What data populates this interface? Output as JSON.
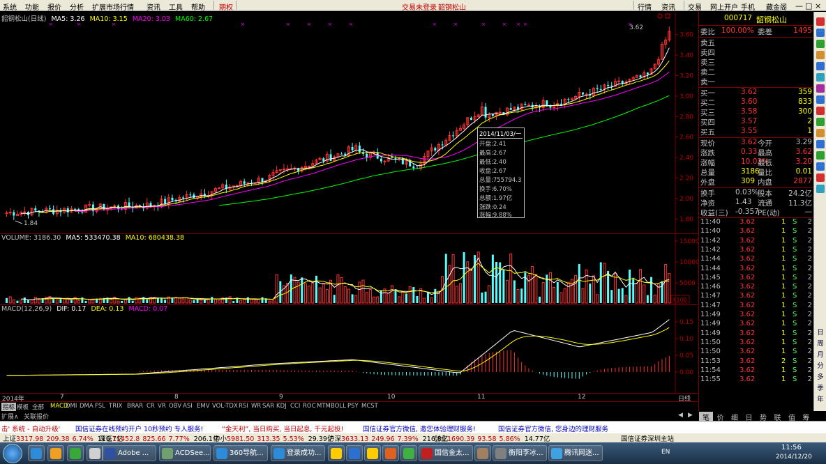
{
  "menu": {
    "items": [
      "系统",
      "功能",
      "报价",
      "分析",
      "扩展市场行情",
      "资讯",
      "工具",
      "帮助"
    ],
    "qiquan": "期权",
    "status_left": "交易未登录",
    "status_name": "韶钢松山",
    "right": [
      "行情",
      "资讯",
      "交易",
      "网上开户",
      "手机",
      "藏金阁"
    ]
  },
  "kline": {
    "title": "韶钢松山(日线)",
    "ma5_label": "MA5: 3.26",
    "ma10_label": "MA10: 3.15",
    "ma20_label": "MA20: 3.03",
    "ma60_label": "MA60: 2.67",
    "last_label": "3.62",
    "low_label": "1.84",
    "price_axis": [
      "3.60",
      "3.40",
      "3.20",
      "3.00",
      "2.80",
      "2.60",
      "2.40",
      "2.20",
      "2.00",
      "1.80"
    ]
  },
  "volume": {
    "title": "VOLUME: 3186.30",
    "ma5": "MA5: 533470.38",
    "ma10": "MA10: 680438.38",
    "axis": [
      "15000",
      "10000",
      "5000"
    ],
    "unit": "X100"
  },
  "macd": {
    "title": "MACD(12,26,9)",
    "dif": "DIF: 0.17",
    "dea": "DEA: 0.13",
    "macd": "MACD: 0.07",
    "axis": [
      "0.15",
      "0.10",
      "0.05",
      "0.00"
    ]
  },
  "xaxis": {
    "labels": [
      "2014年",
      "7",
      "8",
      "9",
      "10",
      "11",
      "12"
    ],
    "period": "日线"
  },
  "tooltip": {
    "date": "2014/11/03/一",
    "lines": [
      "开盘:2.41",
      "最高:2.67",
      "最低:2.40",
      "收盘:2.67",
      "总量:755794.3",
      "换手:6.70%",
      "总额:1.97亿",
      "涨跌:0.24",
      "涨幅:9.88%"
    ]
  },
  "tabs": [
    "指标",
    "模板",
    "全部",
    "MACD",
    "DMI",
    "DMA",
    "FSL",
    "TRIX",
    "BRAR",
    "CR",
    "VR",
    "OBV",
    "ASI",
    "EMV",
    "VOL-TDX",
    "RSI",
    "WR",
    "SAR",
    "KDJ",
    "CCI",
    "ROC",
    "MTM",
    "BOLL",
    "PSY",
    "MCST"
  ],
  "tabs2": [
    "扩展∧",
    "关联报价"
  ],
  "quote": {
    "code": "000717",
    "name": "韶钢松山",
    "weibi_label": "委比",
    "weibi": "100.00%",
    "weicha_label": "委差",
    "weicha": "1495",
    "sells": [
      "卖五",
      "卖四",
      "卖三",
      "卖二",
      "卖一"
    ],
    "buys": [
      {
        "label": "买一",
        "price": "3.62",
        "vol": "359"
      },
      {
        "label": "买二",
        "price": "3.60",
        "vol": "833"
      },
      {
        "label": "买三",
        "price": "3.58",
        "vol": "300"
      },
      {
        "label": "买四",
        "price": "3.57",
        "vol": "2"
      },
      {
        "label": "买五",
        "price": "3.55",
        "vol": "1"
      }
    ],
    "stats": [
      {
        "l1": "现价",
        "v1": "3.62",
        "l2": "今开",
        "v2": "3.29"
      },
      {
        "l1": "涨跌",
        "v1": "0.33",
        "l2": "最高",
        "v2": "3.62"
      },
      {
        "l1": "涨幅",
        "v1": "10.03%",
        "l2": "最低",
        "v2": "3.20"
      },
      {
        "l1": "总量",
        "v1": "3186",
        "l2": "量比",
        "v2": "0.01"
      },
      {
        "l1": "外盘",
        "v1": "309",
        "l2": "内盘",
        "v2": "2877"
      }
    ],
    "stats2": [
      {
        "l1": "换手",
        "v1": "0.03%",
        "l2": "股本",
        "v2": "24.2亿"
      },
      {
        "l1": "净资",
        "v1": "1.43",
        "l2": "流通",
        "v2": "11.3亿"
      },
      {
        "l1": "收益(三)",
        "v1": "-0.357",
        "l2": "PE(动)",
        "v2": "—"
      }
    ],
    "ticks": [
      {
        "t": "11:40",
        "p": "3.62",
        "v": "1",
        "s": "S",
        "n": "2"
      },
      {
        "t": "11:40",
        "p": "3.62",
        "v": "1",
        "s": "S",
        "n": "2"
      },
      {
        "t": "11:42",
        "p": "3.62",
        "v": "1",
        "s": "S",
        "n": "2"
      },
      {
        "t": "11:42",
        "p": "3.62",
        "v": "1",
        "s": "S",
        "n": "2"
      },
      {
        "t": "11:44",
        "p": "3.62",
        "v": "1",
        "s": "S",
        "n": "2"
      },
      {
        "t": "11:44",
        "p": "3.62",
        "v": "1",
        "s": "S",
        "n": "2"
      },
      {
        "t": "11:45",
        "p": "3.62",
        "v": "1",
        "s": "S",
        "n": "2"
      },
      {
        "t": "11:46",
        "p": "3.62",
        "v": "1",
        "s": "S",
        "n": "2"
      },
      {
        "t": "11:47",
        "p": "3.62",
        "v": "1",
        "s": "S",
        "n": "2"
      },
      {
        "t": "11:47",
        "p": "3.62",
        "v": "1",
        "s": "S",
        "n": "2"
      },
      {
        "t": "11:49",
        "p": "3.62",
        "v": "1",
        "s": "S",
        "n": "2"
      },
      {
        "t": "11:49",
        "p": "3.62",
        "v": "1",
        "s": "S",
        "n": "2"
      },
      {
        "t": "11:49",
        "p": "3.62",
        "v": "1",
        "s": "S",
        "n": "2"
      },
      {
        "t": "11:50",
        "p": "3.62",
        "v": "1",
        "s": "S",
        "n": "2"
      },
      {
        "t": "11:50",
        "p": "3.62",
        "v": "1",
        "s": "S",
        "n": "2"
      },
      {
        "t": "11:53",
        "p": "3.62",
        "v": "2",
        "s": "S",
        "n": "2"
      },
      {
        "t": "11:54",
        "p": "3.62",
        "v": "1",
        "s": "S",
        "n": "2"
      },
      {
        "t": "11:55",
        "p": "3.62",
        "v": "1",
        "s": "S",
        "n": "2"
      }
    ]
  },
  "bottom_tabs": [
    "笔",
    "价",
    "细",
    "日",
    "势",
    "联",
    "值",
    "筹"
  ],
  "side_labels": [
    "日",
    "周",
    "月",
    "分",
    "多",
    "季",
    "年"
  ],
  "ticker": [
    "击' 系统 - 自动升级'",
    "国信证券在线预约开户 10秒预约 专人服务!",
    "“金天利”, 当日购买, 当日起息, 千元起投!",
    "国信证券官方微信, 邀您体验理财服务!",
    "国信证券官方微信, 您身边的理财服务"
  ],
  "index": [
    {
      "n": "上证",
      "v": "3317.98",
      "c": "209.38",
      "p": "6.74%",
      "a": "116.7亿"
    },
    {
      "n": "深证",
      "v": "11452.8",
      "c": "825.66",
      "p": "7.77%",
      "a": "206.1亿"
    },
    {
      "n": "中小",
      "v": "5981.50",
      "c": "313.35",
      "p": "5.53%",
      "a": "29.39亿"
    },
    {
      "n": "沪深",
      "v": "3633.13",
      "c": "249.96",
      "p": "7.39%",
      "a": "216.8亿"
    },
    {
      "n": "创业",
      "v": "1690.39",
      "c": "93.58",
      "p": "5.86%",
      "a": "14.77亿"
    }
  ],
  "index_right": "国信证券深圳主站",
  "taskbar": {
    "items": [
      "",
      "",
      "",
      "",
      "Adobe ...",
      "ACDSee...",
      "360导航...",
      "登录成功...",
      "",
      "",
      "",
      "",
      "",
      "国信金太...",
      "",
      "衡阳李冰...",
      "腾讯网迷..."
    ],
    "time": "11:56",
    "date": "2014/12/20",
    "lang": "EN"
  }
}
